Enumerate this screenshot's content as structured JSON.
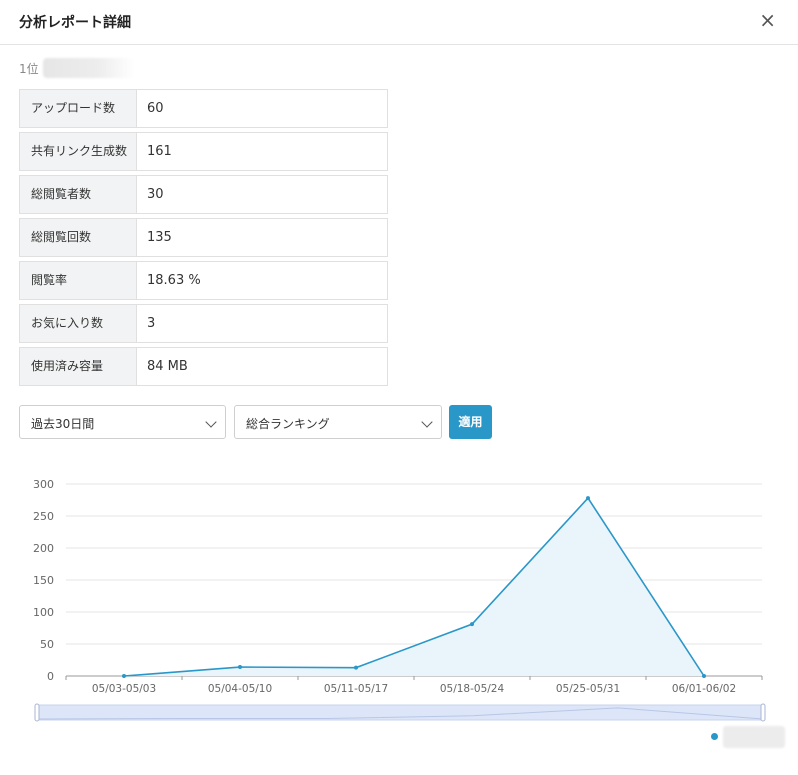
{
  "dialog": {
    "title": "分析レポート詳細",
    "close_label": "×"
  },
  "rank": {
    "label": "1位"
  },
  "stats": [
    {
      "label": "アップロード数",
      "value": "60"
    },
    {
      "label": "共有リンク生成数",
      "value": "161"
    },
    {
      "label": "総閲覧者数",
      "value": "30"
    },
    {
      "label": "総閲覧回数",
      "value": "135"
    },
    {
      "label": "閲覧率",
      "value": "18.63 %"
    },
    {
      "label": "お気に入り数",
      "value": "3"
    },
    {
      "label": "使用済み容量",
      "value": "84 MB"
    }
  ],
  "filters": {
    "period": "過去30日間",
    "ranking": "総合ランキング",
    "apply_label": "適用"
  },
  "colors": {
    "accent": "#2a97c9",
    "area_fill": "#eaf4fb",
    "slider_fill": "#dde6f8"
  },
  "chart_data": {
    "type": "area",
    "categories": [
      "05/03-05/03",
      "05/04-05/10",
      "05/11-05/17",
      "05/18-05/24",
      "05/25-05/31",
      "06/01-06/02"
    ],
    "values": [
      0,
      14,
      13,
      81,
      278,
      0
    ],
    "ylim": [
      0,
      300
    ],
    "yticks": [
      0,
      50,
      100,
      150,
      200,
      250,
      300
    ],
    "grid": true,
    "legend": "bottom-right",
    "data_zoom": true
  }
}
